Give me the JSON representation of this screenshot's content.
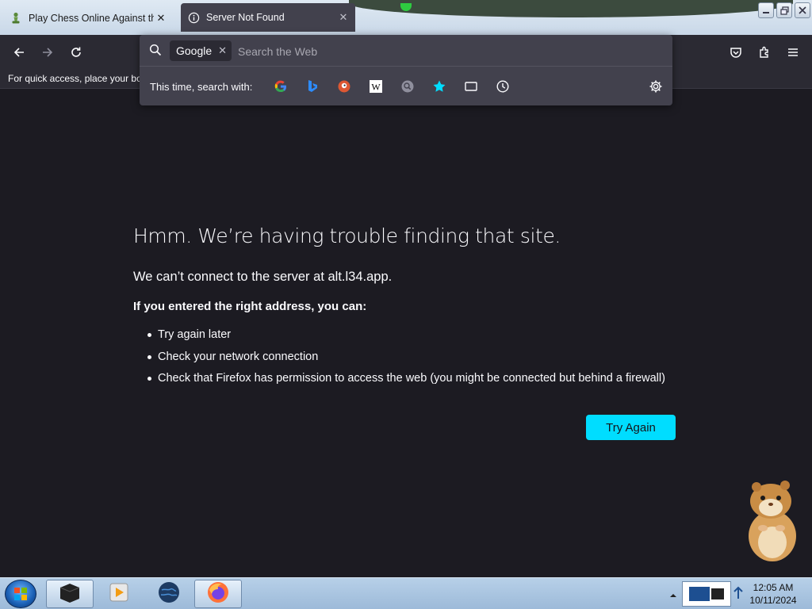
{
  "browser": {
    "tabs": [
      {
        "title": "Play Chess Online Against the C",
        "close": "✕"
      },
      {
        "title": "Server Not Found",
        "close": "✕"
      }
    ],
    "bookmarks_hint": "For quick access, place your boo"
  },
  "urlbar": {
    "engine_chip": "Google",
    "chip_close": "✕",
    "placeholder": "Search the Web",
    "search_with_label": "This time, search with:",
    "engines": [
      "google",
      "bing",
      "duckduckgo",
      "wikipedia",
      "other-search",
      "bookmarks",
      "tabs",
      "history"
    ]
  },
  "error_page": {
    "title": "Hmm. We’re having trouble finding that site.",
    "subtitle": "We can’t connect to the server at alt.l34.app.",
    "intro": "If you entered the right address, you can:",
    "suggestions": [
      "Try again later",
      "Check your network connection",
      "Check that Firefox has permission to access the web (you might be connected but behind a firewall)"
    ],
    "try_again": "Try Again"
  },
  "taskbar": {
    "time": "12:05 AM",
    "date": "10/11/2024"
  },
  "colors": {
    "page_bg": "#1c1b22",
    "toolbar_bg": "#2b2a33",
    "popup_bg": "#42414d",
    "accent": "#00ddff"
  }
}
